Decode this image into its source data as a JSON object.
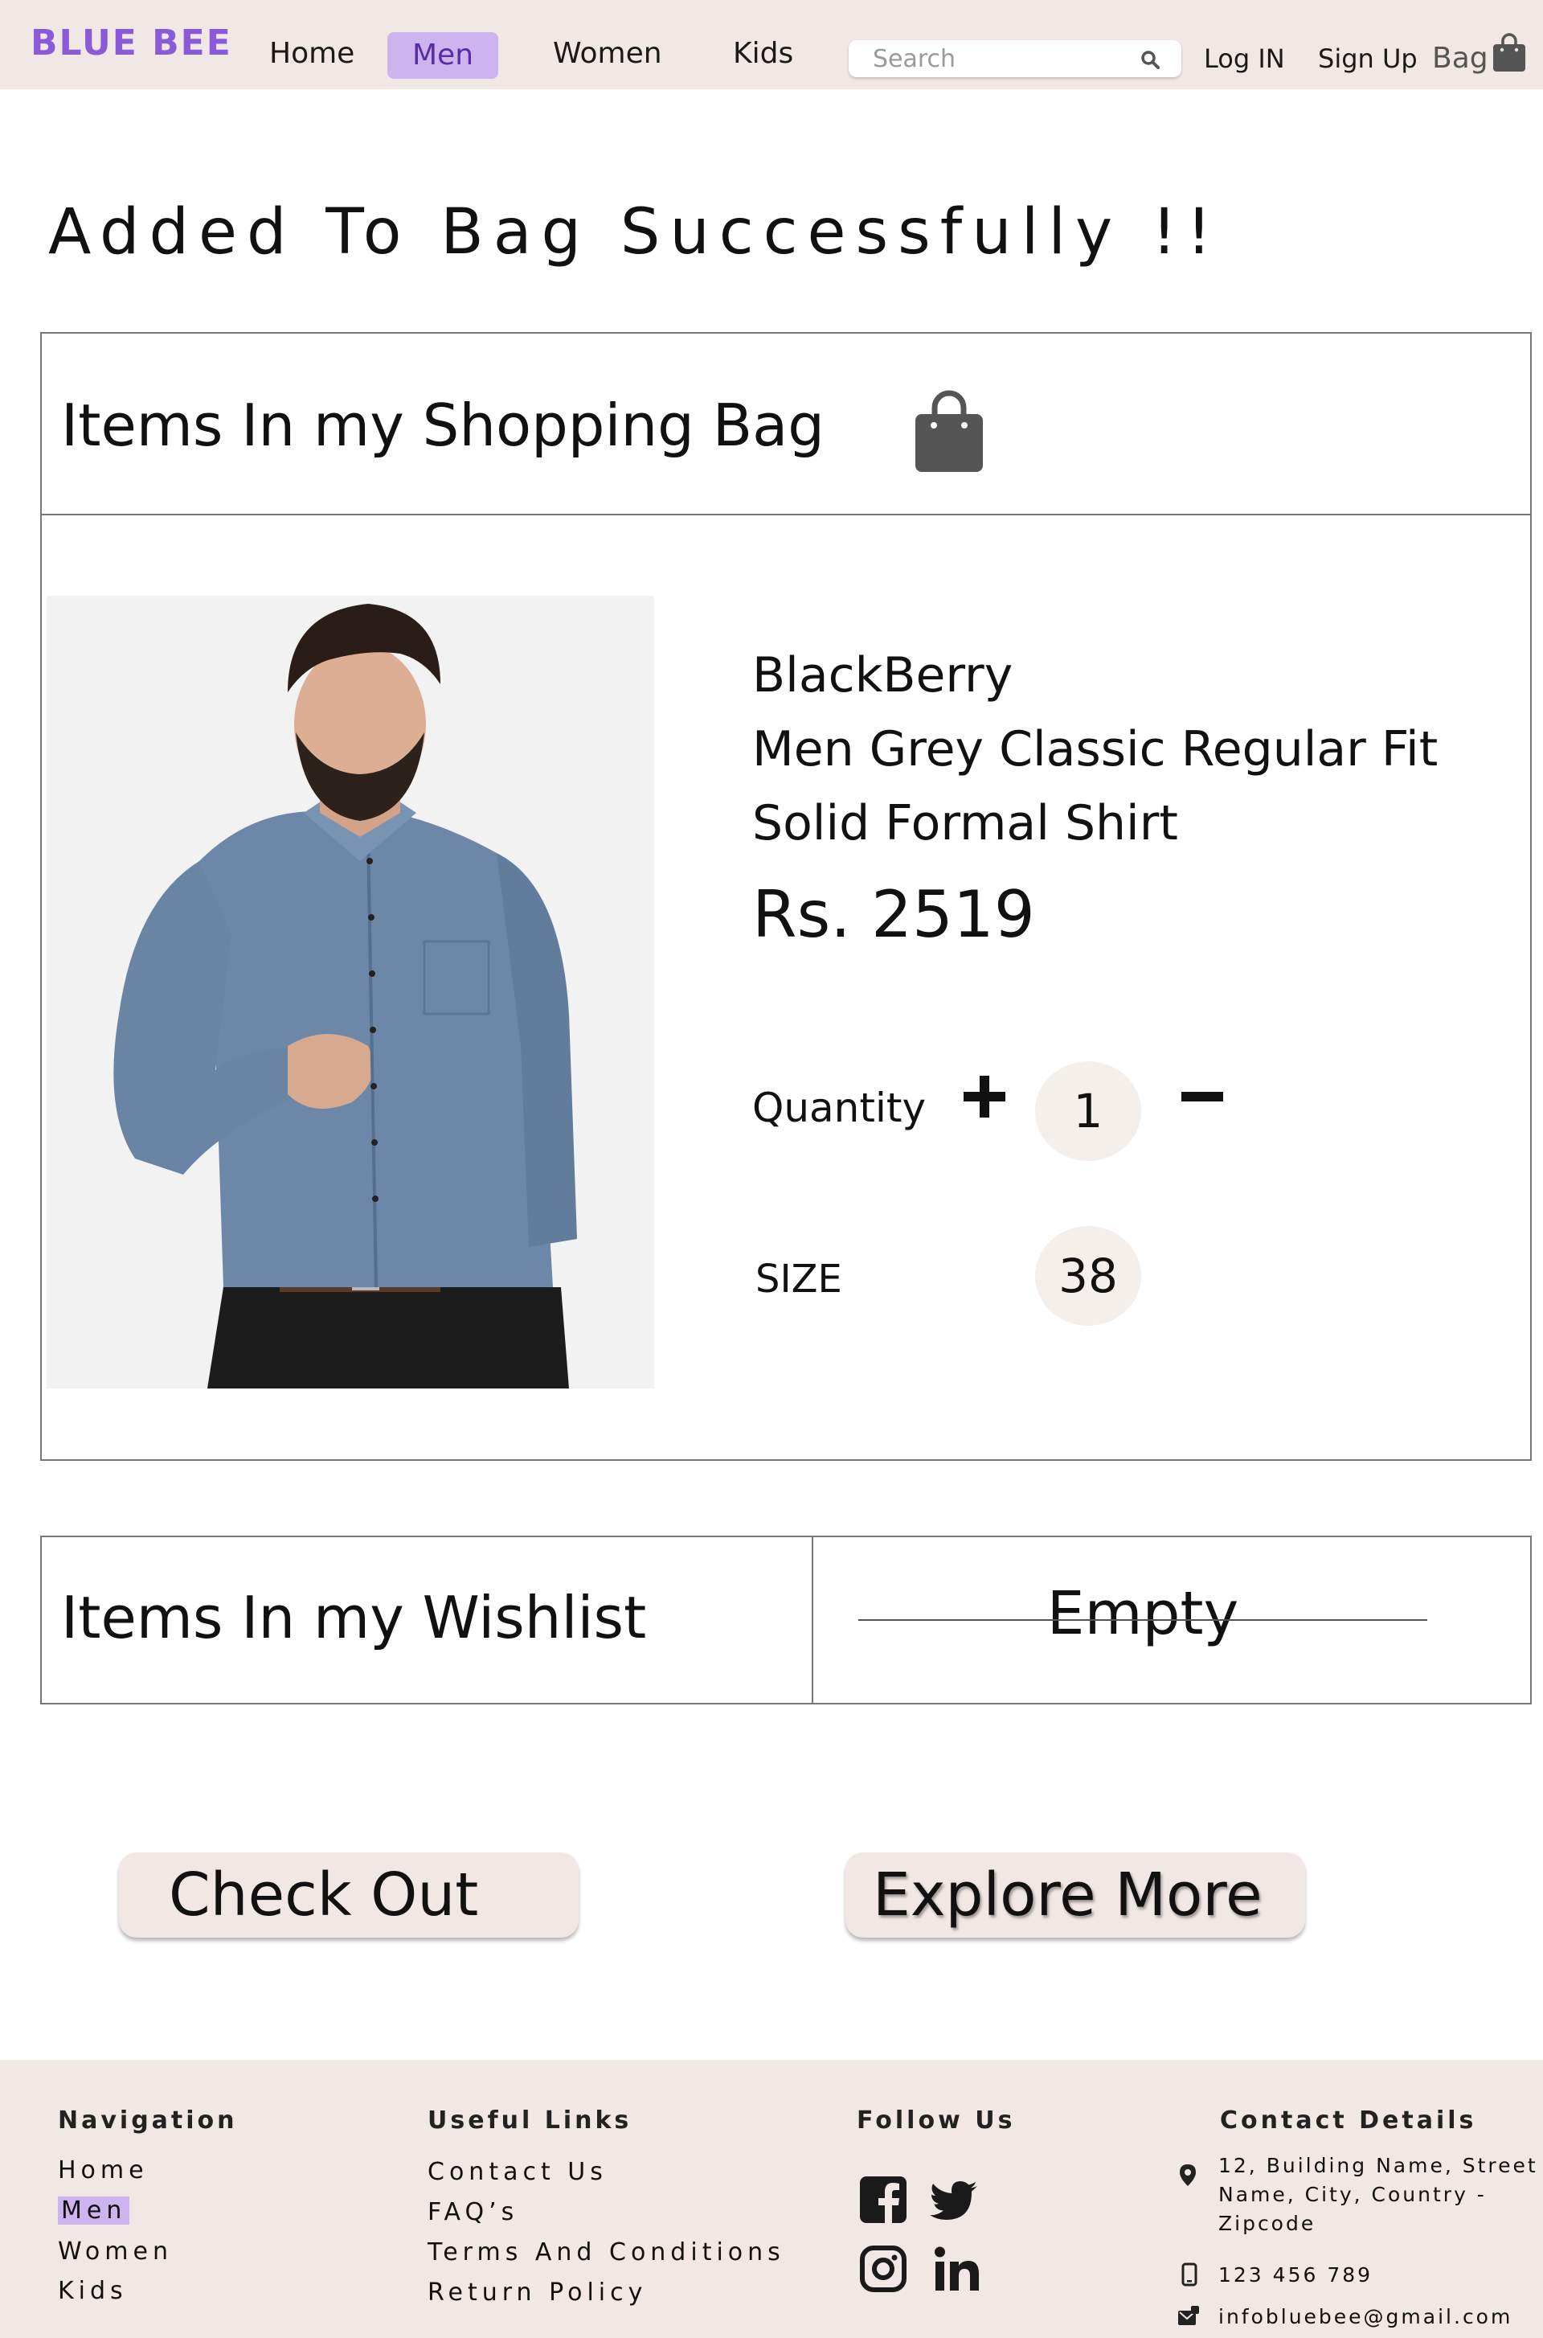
{
  "header": {
    "brand": "BLUE BEE",
    "nav": [
      "Home",
      "Men",
      "Women",
      "Kids"
    ],
    "active_nav": "Men",
    "search_placeholder": "Search",
    "login": "Log IN",
    "signup": "Sign Up",
    "bag": "Bag"
  },
  "page_title": "Added To Bag Successfully !!",
  "bag": {
    "heading": "Items In my Shopping  Bag",
    "product": {
      "brand": "BlackBerry",
      "name_line1": "Men Grey Classic Regular Fit",
      "name_line2": "Solid Formal Shirt",
      "price": "Rs. 2519",
      "quantity_label": "Quantity",
      "quantity": "1",
      "size_label": "SIZE",
      "size": "38"
    }
  },
  "wishlist": {
    "heading": "Items In my Wishlist",
    "status": "Empty"
  },
  "buttons": {
    "checkout": "Check Out",
    "explore": "Explore More"
  },
  "footer": {
    "navigation": {
      "heading": "Navigation",
      "links": [
        "Home",
        "Men",
        "Women",
        "Kids"
      ]
    },
    "useful_links": {
      "heading": "Useful  Links",
      "links": [
        "Contact Us",
        "FAQ’s",
        "Terms And Conditions",
        "Return Policy"
      ]
    },
    "follow_us": {
      "heading": "Follow Us",
      "icons": [
        "facebook-icon",
        "twitter-icon",
        "instagram-icon",
        "linkedin-icon"
      ]
    },
    "contact": {
      "heading": "Contact Details",
      "address_line1": "12, Building Name, Street",
      "address_line2": "Name, City, Country -",
      "address_line3": "Zipcode",
      "phone": "123 456 789",
      "email": "infobluebee@gmail.com"
    }
  },
  "colors": {
    "brand": "#8a5bd8",
    "header_bg": "#f1e7e4",
    "active_nav_bg": "#cdb4ef",
    "bubble_bg": "#f5efec"
  }
}
